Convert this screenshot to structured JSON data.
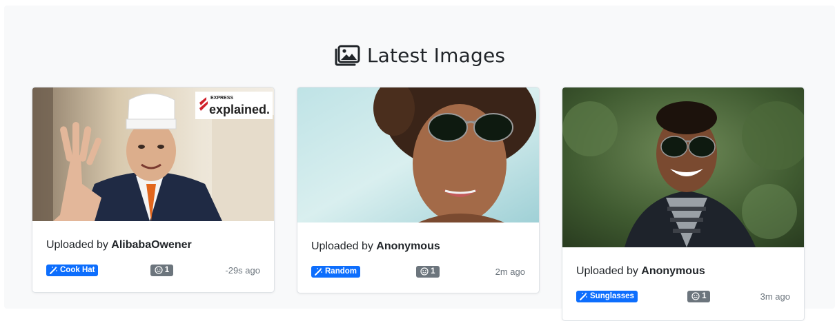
{
  "section": {
    "title": "Latest Images",
    "title_icon": "images-icon"
  },
  "cards": [
    {
      "uploaded_prefix": "Uploaded by",
      "uploader": "AlibabaOwener",
      "filter_label": "Cook Hat",
      "filter_icon": "magic-wand-icon",
      "faces_count": "1",
      "faces_icon": "smiley-icon",
      "time_ago": "-29s ago",
      "watermark_small": "EXPRESS",
      "watermark_big": "explained."
    },
    {
      "uploaded_prefix": "Uploaded by",
      "uploader": "Anonymous",
      "filter_label": "Random",
      "filter_icon": "magic-wand-icon",
      "faces_count": "1",
      "faces_icon": "smiley-icon",
      "time_ago": "2m ago"
    },
    {
      "uploaded_prefix": "Uploaded by",
      "uploader": "Anonymous",
      "filter_label": "Sunglasses",
      "filter_icon": "magic-wand-icon",
      "faces_count": "1",
      "faces_icon": "smiley-icon",
      "time_ago": "3m ago"
    }
  ],
  "colors": {
    "background": "#f8f9fa",
    "filter_badge": "#0d6efd",
    "faces_badge": "#6c757d",
    "muted_text": "#6c757d"
  }
}
